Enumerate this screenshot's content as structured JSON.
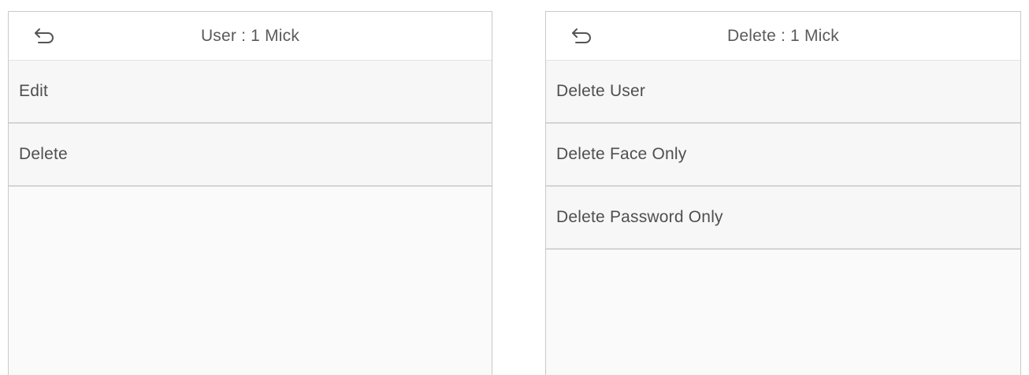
{
  "left_panel": {
    "title": "User : 1 Mick",
    "back_icon": "back-arrow-icon",
    "items": [
      {
        "label": "Edit"
      },
      {
        "label": "Delete"
      }
    ]
  },
  "right_panel": {
    "title": "Delete : 1 Mick",
    "back_icon": "back-arrow-icon",
    "items": [
      {
        "label": "Delete User"
      },
      {
        "label": "Delete Face Only"
      },
      {
        "label": "Delete Password Only"
      }
    ]
  },
  "colors": {
    "text": "#4f4f4f",
    "border": "#c9c9c9",
    "divider": "#d4d4d4",
    "background": "#fafafa"
  }
}
